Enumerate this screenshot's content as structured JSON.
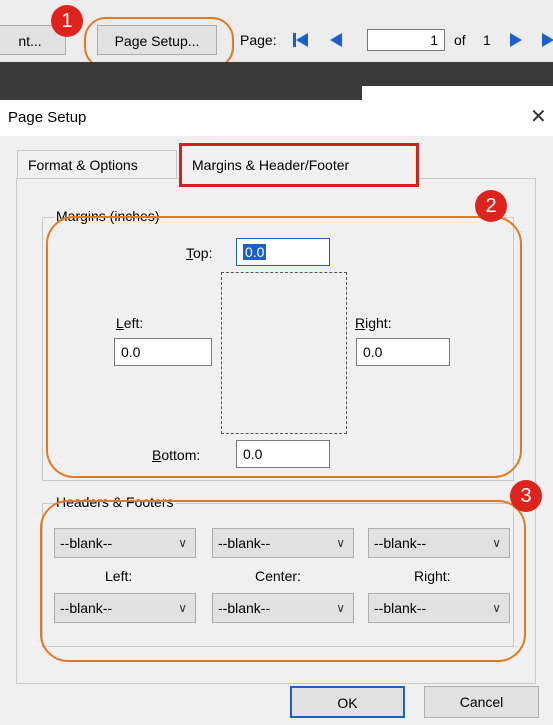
{
  "toolbar": {
    "print_partial": "nt...",
    "page_setup_label": "Page Setup...",
    "page_label": "Page:",
    "page_value": "1",
    "of_text": "of",
    "total_pages": "1"
  },
  "dialog": {
    "title": "Page Setup",
    "tabs": [
      {
        "label": "Format & Options"
      },
      {
        "label": "Margins & Header/Footer"
      }
    ],
    "margins": {
      "legend": "Margins (inches)",
      "top_label": "Top:",
      "top_value": "0.0",
      "left_label": "Left:",
      "left_value": "0.0",
      "right_label": "Right:",
      "right_value": "0.0",
      "bottom_label": "Bottom:",
      "bottom_value": "0.0"
    },
    "headers_footers": {
      "legend": "Headers & Footers",
      "header_left": "--blank--",
      "header_center": "--blank--",
      "header_right": "--blank--",
      "left_label": "Left:",
      "center_label": "Center:",
      "right_label": "Right:",
      "footer_left": "--blank--",
      "footer_center": "--blank--",
      "footer_right": "--blank--"
    },
    "ok_label": "OK",
    "cancel_label": "Cancel"
  },
  "callouts": [
    "1",
    "2",
    "3"
  ],
  "colors": {
    "callout_ring": "#e07b20",
    "badge": "#e0221c",
    "tab_highlight": "#d32020",
    "accent_blue": "#1a5fd0"
  }
}
